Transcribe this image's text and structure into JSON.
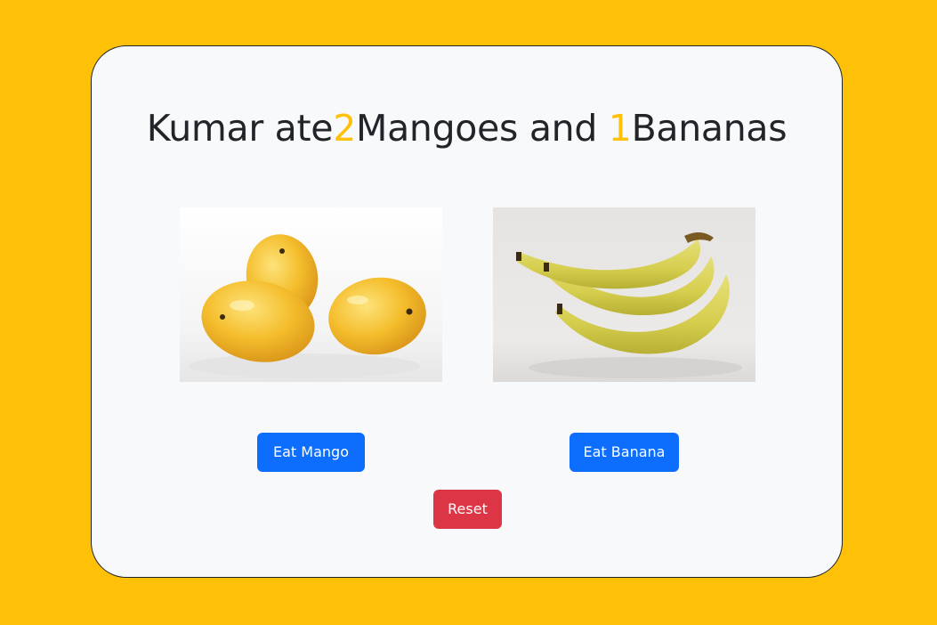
{
  "heading": {
    "prefix": "Kumar ate",
    "mango_count": "2",
    "mango_label": "Mangoes and ",
    "banana_count": "1",
    "banana_label": "Bananas"
  },
  "buttons": {
    "eat_mango": "Eat Mango",
    "eat_banana": "Eat Banana",
    "reset": "Reset"
  },
  "images": {
    "mango": "mango-photo",
    "banana": "banana-photo"
  },
  "colors": {
    "background": "#ffc107",
    "card": "#f8f9fa",
    "count_highlight": "#ffc107",
    "primary_button": "#0d6efd",
    "danger_button": "#dc3545"
  }
}
